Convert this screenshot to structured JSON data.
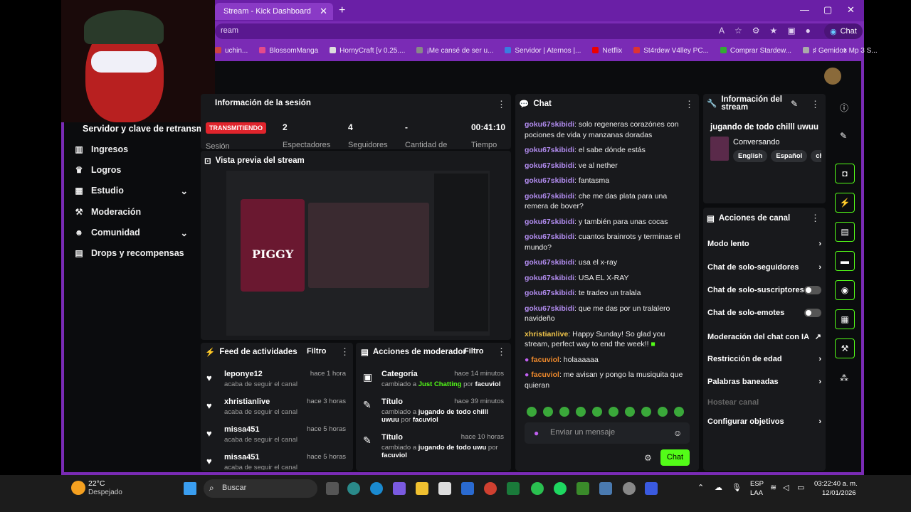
{
  "browser": {
    "tab_title": "Stream - Kick Dashboard",
    "address": "ream",
    "chat_button": "Chat",
    "bookmarks": [
      "uchin...",
      "BlossomManga",
      "HornyCraft [v 0.25....",
      "¡Me cansé de ser u...",
      "Servidor | Aternos |...",
      "Netflix",
      "St4rdew V4lley PC...",
      "Comprar Stardew...",
      "♯ Gemidos Mp 3 S..."
    ]
  },
  "sidebar": {
    "top_label": "Servidor y clave de retransm",
    "items": [
      {
        "label": "Ingresos",
        "icon": "bar-chart-icon"
      },
      {
        "label": "Logros",
        "icon": "trophy-icon"
      },
      {
        "label": "Estudio",
        "icon": "grid-icon"
      },
      {
        "label": "Moderación",
        "icon": "hammer-icon"
      },
      {
        "label": "Comunidad",
        "icon": "people-icon"
      },
      {
        "label": "Drops y recompensas",
        "icon": "gift-icon"
      }
    ]
  },
  "session": {
    "title": "Información de la sesión",
    "live_badge": "TRANSMITIENDO",
    "session_label": "Sesión",
    "stats": [
      {
        "value": "2",
        "label": "Espectadores"
      },
      {
        "value": "4",
        "label": "Seguidores"
      },
      {
        "value": "-",
        "label": "Cantidad de"
      },
      {
        "value": "00:41:10",
        "label": "Tiempo"
      }
    ]
  },
  "preview": {
    "title": "Vista previa del stream",
    "game": "PIGGY"
  },
  "feed": {
    "title": "Feed de actividades",
    "filter": "Filtro",
    "items": [
      {
        "name": "leponye12",
        "sub": "acaba de seguir el canal",
        "time": "hace 1 hora"
      },
      {
        "name": "xhristianlive",
        "sub": "acaba de seguir el canal",
        "time": "hace 3 horas"
      },
      {
        "name": "missa451",
        "sub": "acaba de seguir el canal",
        "time": "hace 5 horas"
      },
      {
        "name": "missa451",
        "sub": "acaba de seguir el canal",
        "time": "hace 5 horas"
      }
    ]
  },
  "modactions": {
    "title": "Acciones de moderador",
    "filter": "Filtro",
    "items": [
      {
        "name": "Categoría",
        "time": "hace 14 minutos",
        "pre": "cambiado a",
        "value": "Just Chatting",
        "by": "por",
        "user": "facuviol"
      },
      {
        "name": "Título",
        "time": "hace 39 minutos",
        "pre": "cambiado a",
        "value": "jugando de todo chilll uwuu",
        "by": "por",
        "user": "facuviol"
      },
      {
        "name": "Título",
        "time": "hace 10 horas",
        "pre": "cambiado a",
        "value": "jugando de todo uwu",
        "by": "por",
        "user": "facuviol"
      }
    ]
  },
  "chat": {
    "title": "Chat",
    "input_placeholder": "Enviar un mensaje",
    "send": "Chat",
    "messages": [
      {
        "user": "goku67skibidi",
        "text": "solo regeneras corazónes con pociones de vida y manzanas doradas"
      },
      {
        "user": "goku67skibidi",
        "text": "el sabe dónde estás"
      },
      {
        "user": "goku67skibidi",
        "text": "ve al nether"
      },
      {
        "user": "goku67skibidi",
        "text": "fantasma"
      },
      {
        "user": "goku67skibidi",
        "text": "che me das plata para una remera de bover?"
      },
      {
        "user": "goku67skibidi",
        "text": "y también para unas cocas"
      },
      {
        "user": "goku67skibidi",
        "text": "cuantos brainrots y terminas el mundo?"
      },
      {
        "user": "goku67skibidi",
        "text": "usa el x-ray"
      },
      {
        "user": "goku67skibidi",
        "text": "USA EL X-RAY"
      },
      {
        "user": "goku67skibidi",
        "text": "te tradeo un tralala"
      },
      {
        "user": "goku67skibidi",
        "text": "que me das por un tralalero navideño"
      },
      {
        "user": "xhristianlive",
        "text": "Happy Sunday! So glad you stream, perfect way to end the week!!"
      },
      {
        "user": "facuviol",
        "text": "holaaaaaa"
      },
      {
        "user": "facuviol",
        "text": "me avisan y pongo la musiquita que quieran"
      }
    ]
  },
  "info": {
    "title": "Información del stream",
    "stream_title": "jugando de todo chilll uwuu",
    "category": "Conversando",
    "tags": [
      "English",
      "Español",
      "chil"
    ]
  },
  "actions": {
    "title": "Acciones de canal",
    "items": [
      "Modo lento",
      "Chat de solo-seguidores",
      "Chat de solo-suscriptores",
      "Chat de solo-emotes",
      "Moderación del chat con IA",
      "Restricción de edad",
      "Palabras baneadas",
      "Hostear canal",
      "Configurar objetivos"
    ]
  },
  "taskbar": {
    "temp": "22°C",
    "weather": "Despejado",
    "search": "Buscar",
    "lang1": "ESP",
    "lang2": "LAA",
    "time": "03:22:40 a. m.",
    "date": "12/01/2026"
  }
}
